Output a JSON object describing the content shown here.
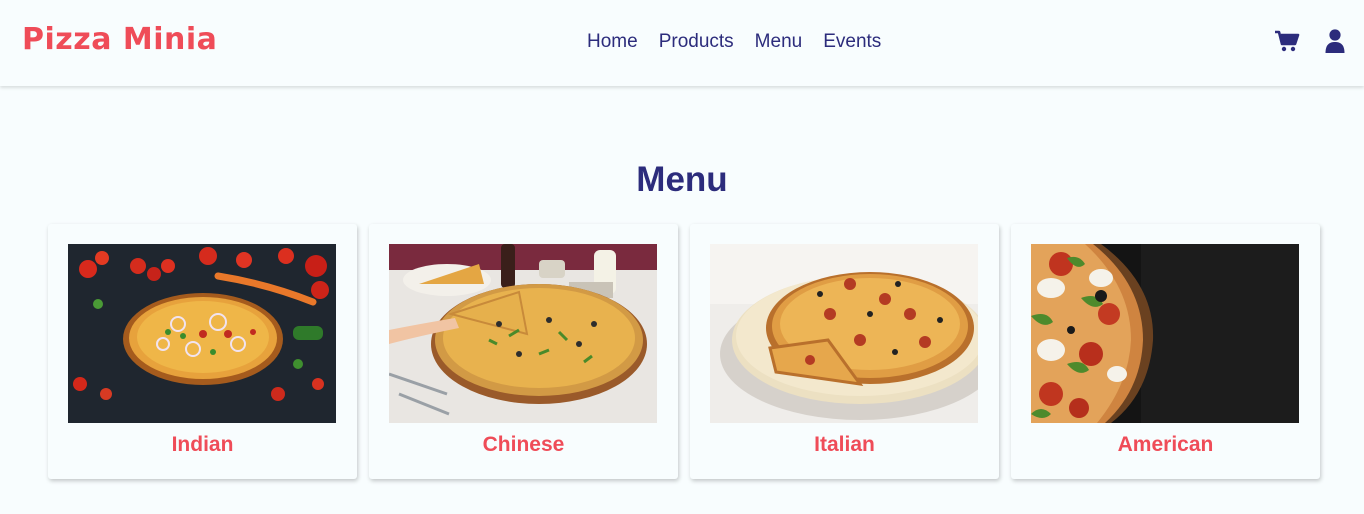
{
  "brand": {
    "name": "Pizza Minia"
  },
  "nav": {
    "links": [
      "Home",
      "Products",
      "Menu",
      "Events"
    ],
    "icons": [
      "shopping-cart-icon",
      "user-icon"
    ]
  },
  "main": {
    "heading": "Menu",
    "cards": [
      {
        "label": "Indian",
        "image": "indian-pizza-image"
      },
      {
        "label": "Chinese",
        "image": "chinese-pizza-image"
      },
      {
        "label": "Italian",
        "image": "italian-pizza-image"
      },
      {
        "label": "American",
        "image": "american-pizza-image"
      }
    ]
  },
  "colors": {
    "accent": "#ef4c58",
    "navy": "#2c2c7c",
    "background": "#f8fdfe"
  }
}
